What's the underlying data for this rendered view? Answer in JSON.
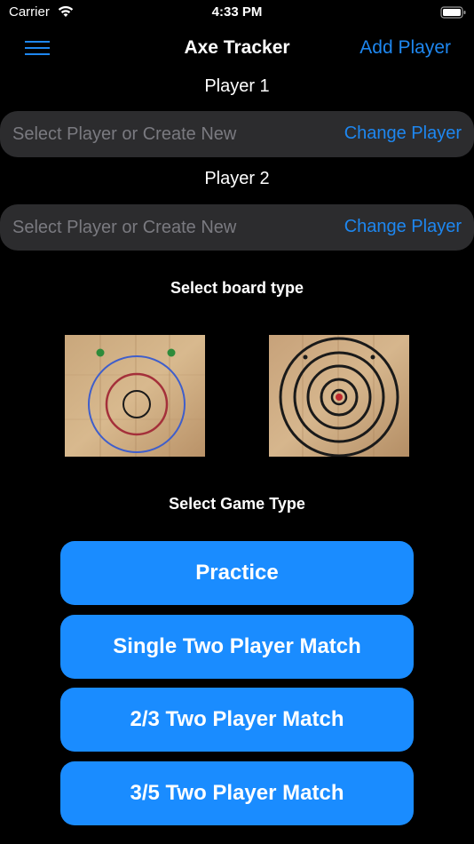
{
  "status_bar": {
    "carrier": "Carrier",
    "time": "4:33 PM"
  },
  "nav": {
    "title": "Axe Tracker",
    "add_player_label": "Add Player",
    "menu_icon": "hamburger-menu-icon",
    "accent_color": "#1e87f0"
  },
  "players": [
    {
      "label": "Player 1",
      "placeholder": "Select Player or Create New",
      "value": "",
      "change_label": "Change Player"
    },
    {
      "label": "Player 2",
      "placeholder": "Select Player or Create New",
      "value": "",
      "change_label": "Change Player"
    }
  ],
  "board_section": {
    "heading": "Select board type",
    "boards": [
      {
        "icon": "wooden-target-board-blue-red-rings-icon"
      },
      {
        "icon": "wooden-target-board-black-rings-icon"
      }
    ]
  },
  "game_section": {
    "heading": "Select Game Type",
    "button_color": "#1a8cff",
    "buttons": [
      "Practice",
      "Single Two Player Match",
      "2/3 Two Player Match",
      "3/5 Two Player Match"
    ]
  }
}
